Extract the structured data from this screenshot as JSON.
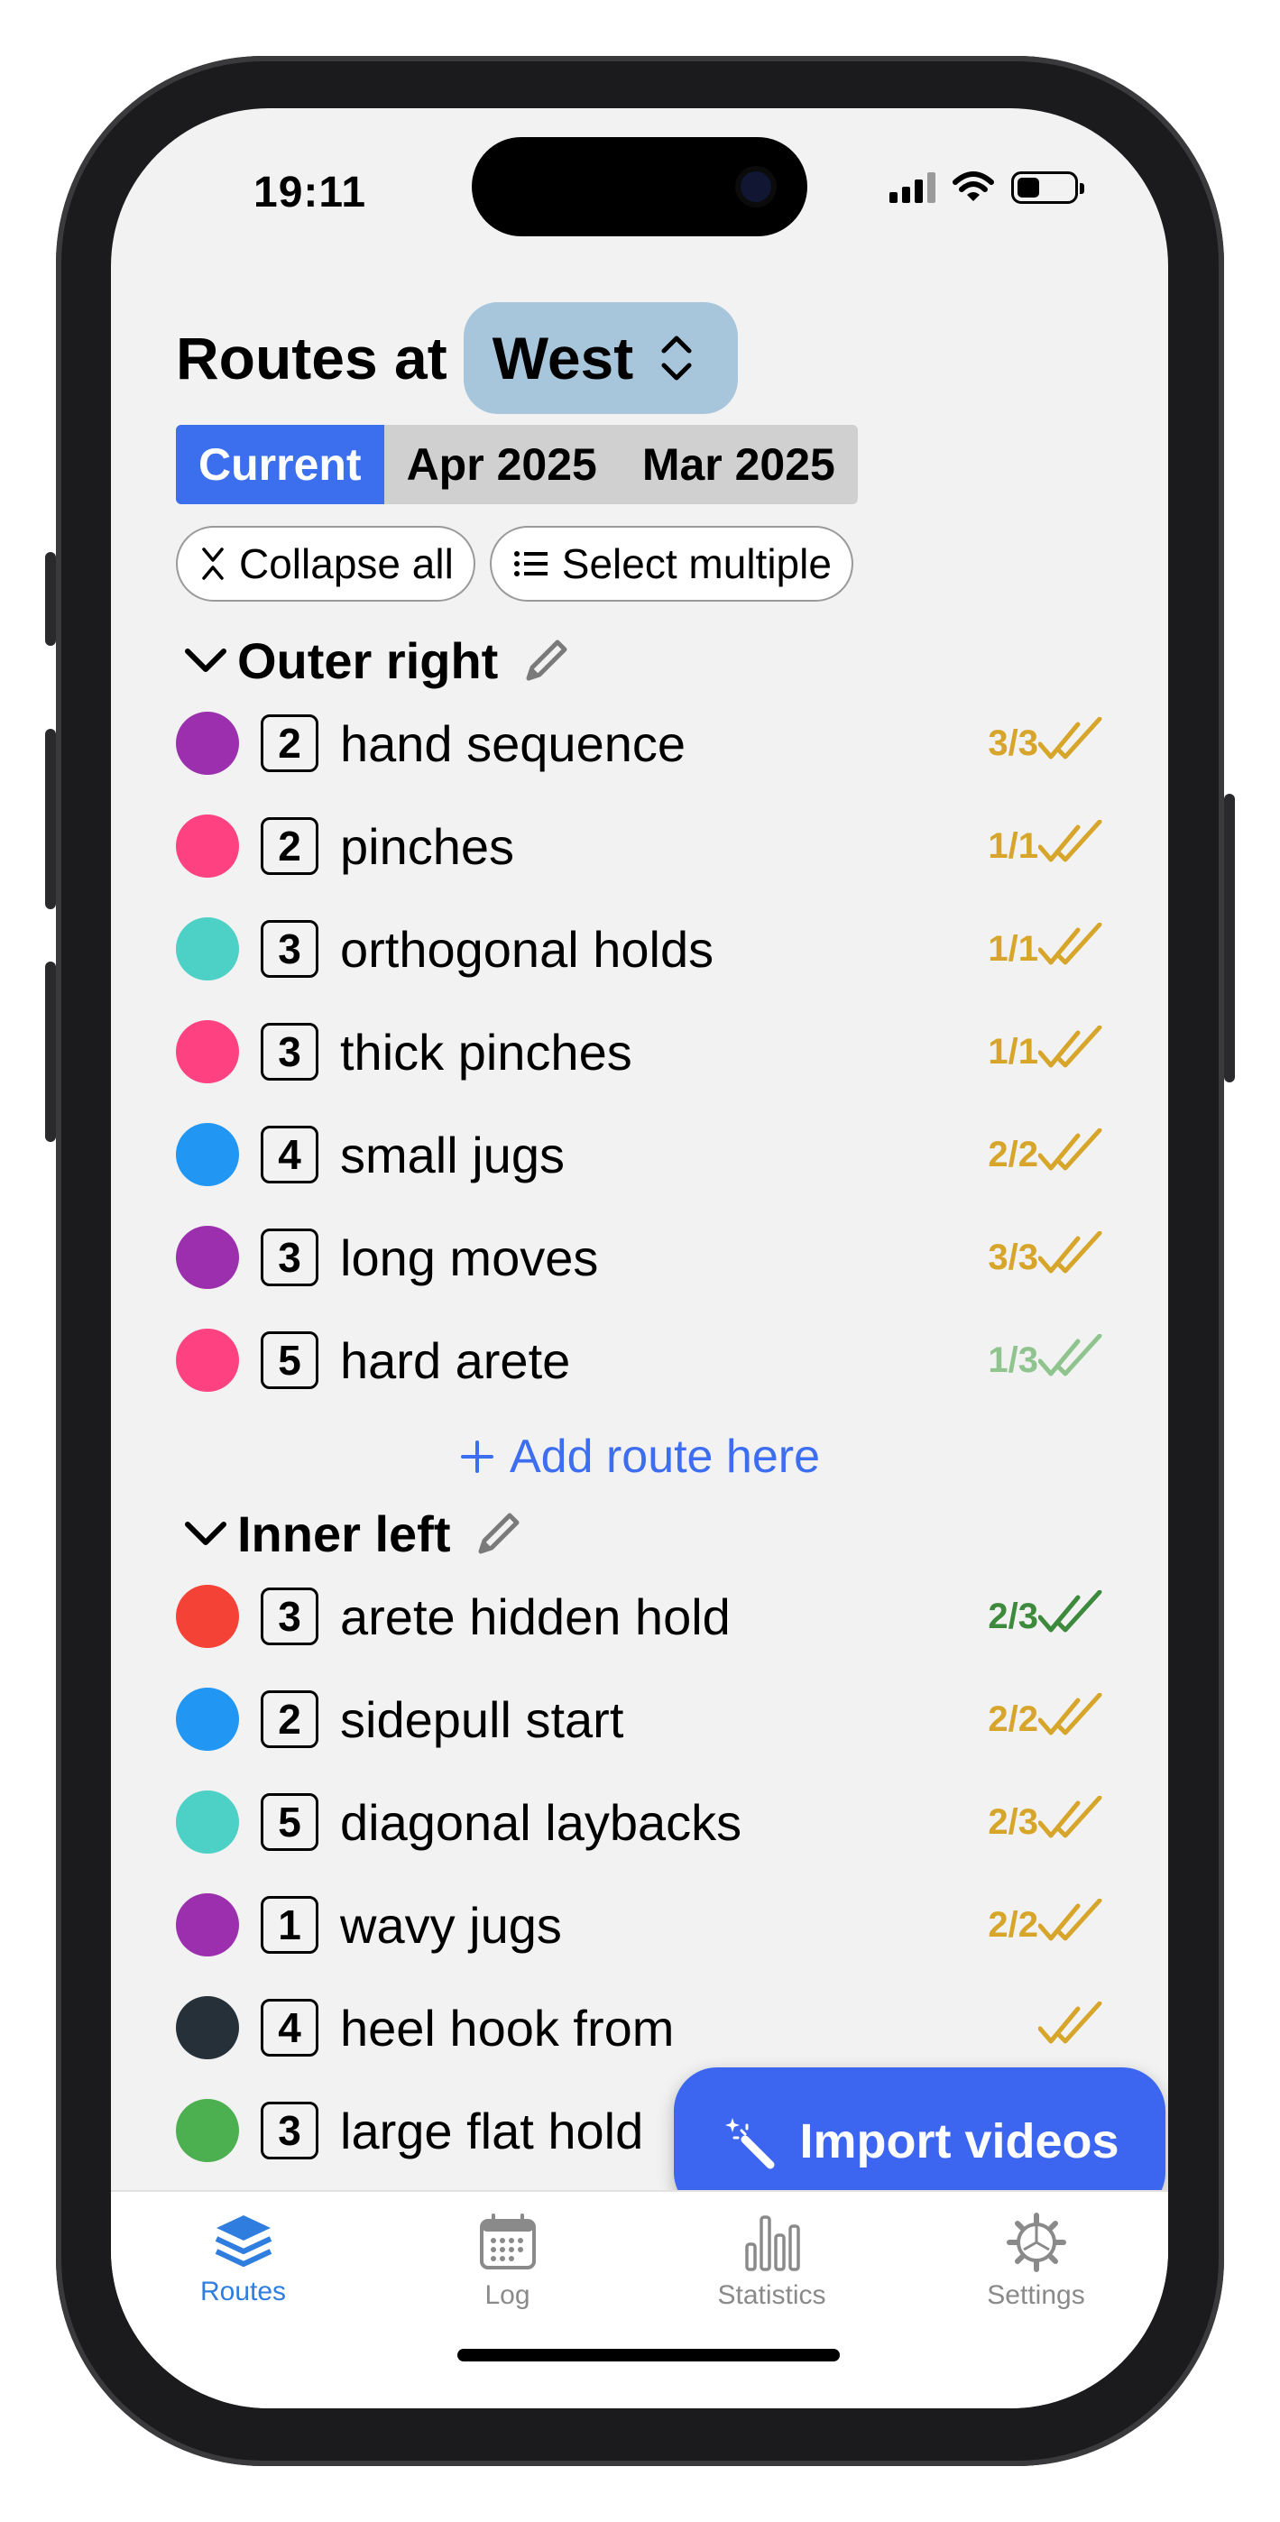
{
  "status": {
    "time": "19:11"
  },
  "header": {
    "title_prefix": "Routes at",
    "gym": "West"
  },
  "segments": [
    {
      "label": "Current",
      "active": true
    },
    {
      "label": "Apr 2025",
      "active": false
    },
    {
      "label": "Mar 2025",
      "active": false
    }
  ],
  "actions": {
    "collapse_label": "Collapse all",
    "select_label": "Select multiple"
  },
  "sections": [
    {
      "title": "Outer right",
      "routes": [
        {
          "color": "#9b2fae",
          "grade": "2",
          "name": "hand sequence",
          "count": "3/3",
          "status": "gold"
        },
        {
          "color": "#fe4281",
          "grade": "2",
          "name": "pinches",
          "count": "1/1",
          "status": "gold"
        },
        {
          "color": "#4dd0c6",
          "grade": "3",
          "name": "orthogonal holds",
          "count": "1/1",
          "status": "gold"
        },
        {
          "color": "#fe4281",
          "grade": "3",
          "name": "thick pinches",
          "count": "1/1",
          "status": "gold"
        },
        {
          "color": "#2196f3",
          "grade": "4",
          "name": "small jugs",
          "count": "2/2",
          "status": "gold"
        },
        {
          "color": "#9b2fae",
          "grade": "3",
          "name": "long moves",
          "count": "3/3",
          "status": "gold"
        },
        {
          "color": "#fe4281",
          "grade": "5",
          "name": "hard arete",
          "count": "1/3",
          "status": "lightgreen"
        }
      ],
      "add_label": "Add route here"
    },
    {
      "title": "Inner left",
      "routes": [
        {
          "color": "#f44336",
          "grade": "3",
          "name": "arete hidden hold",
          "count": "2/3",
          "status": "green"
        },
        {
          "color": "#2196f3",
          "grade": "2",
          "name": "sidepull start",
          "count": "2/2",
          "status": "gold"
        },
        {
          "color": "#4dd0c6",
          "grade": "5",
          "name": "diagonal laybacks",
          "count": "2/3",
          "status": "gold"
        },
        {
          "color": "#9b2fae",
          "grade": "1",
          "name": "wavy jugs",
          "count": "2/2",
          "status": "gold"
        },
        {
          "color": "#263038",
          "grade": "4",
          "name": "heel hook from",
          "count": "",
          "status": "gold"
        },
        {
          "color": "#4caf50",
          "grade": "3",
          "name": "large flat hold",
          "count": "",
          "status": "none"
        }
      ]
    }
  ],
  "fab": {
    "label": "Import videos"
  },
  "tabs": [
    {
      "label": "Routes",
      "active": true,
      "icon": "layers-icon"
    },
    {
      "label": "Log",
      "active": false,
      "icon": "calendar-icon"
    },
    {
      "label": "Statistics",
      "active": false,
      "icon": "bar-chart-icon"
    },
    {
      "label": "Settings",
      "active": false,
      "icon": "gear-icon"
    }
  ],
  "colors": {
    "accent": "#3b6fee",
    "gold": "#d6a52a",
    "lightgreen": "#8fc48f",
    "green": "#3d8a3d",
    "tab_active": "#2f7ddf"
  }
}
